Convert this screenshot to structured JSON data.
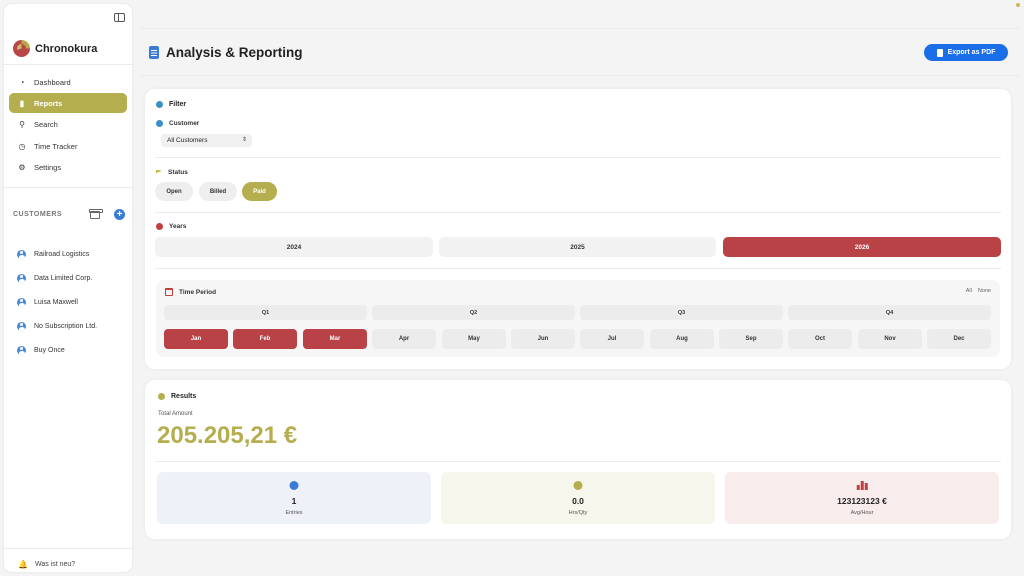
{
  "app": {
    "name": "Chronokura"
  },
  "colors": {
    "accent": "#b5ae4e",
    "primary": "#1a6ee8",
    "danger": "#b84246"
  },
  "sidebar": {
    "nav": [
      {
        "label": "Dashboard",
        "icon": "pie-chart-icon",
        "active": false
      },
      {
        "label": "Reports",
        "icon": "bar-chart-icon",
        "active": true
      },
      {
        "label": "Search",
        "icon": "search-icon",
        "active": false
      },
      {
        "label": "Time Tracker",
        "icon": "timer-icon",
        "active": false
      },
      {
        "label": "Settings",
        "icon": "gear-icon",
        "active": false
      }
    ],
    "customers_title": "CUSTOMERS",
    "customers": [
      "Railroad Logistics",
      "Data Limited Corp.",
      "Luisa Maxwell",
      "No Subscription Ltd.",
      "Buy Once"
    ],
    "whats_new": "Was ist neu?"
  },
  "header": {
    "title": "Analysis & Reporting",
    "export_label": "Export as PDF"
  },
  "filter": {
    "title": "Filter",
    "customer_label": "Customer",
    "customer_value": "All Customers",
    "status_label": "Status",
    "statuses": [
      {
        "label": "Open",
        "active": false
      },
      {
        "label": "Billed",
        "active": false
      },
      {
        "label": "Paid",
        "active": true
      }
    ],
    "years_label": "Years",
    "years": [
      {
        "label": "2024",
        "active": false
      },
      {
        "label": "2025",
        "active": false
      },
      {
        "label": "2026",
        "active": true
      }
    ],
    "period_label": "Time Period",
    "period_all": "All",
    "period_none": "None",
    "quarters": [
      "Q1",
      "Q2",
      "Q3",
      "Q4"
    ],
    "months": [
      {
        "label": "Jan",
        "active": true
      },
      {
        "label": "Feb",
        "active": true
      },
      {
        "label": "Mar",
        "active": true
      },
      {
        "label": "Apr",
        "active": false
      },
      {
        "label": "May",
        "active": false
      },
      {
        "label": "Jun",
        "active": false
      },
      {
        "label": "Jul",
        "active": false
      },
      {
        "label": "Aug",
        "active": false
      },
      {
        "label": "Sep",
        "active": false
      },
      {
        "label": "Oct",
        "active": false
      },
      {
        "label": "Nov",
        "active": false
      },
      {
        "label": "Dec",
        "active": false
      }
    ]
  },
  "results": {
    "title": "Results",
    "total_label": "Total Amount",
    "total_amount": "205.205,21 €",
    "stats": [
      {
        "value": "1",
        "label": "Entries",
        "icon": "list-icon",
        "bg": "#eef2f8",
        "icon_color": "#3a7bd5"
      },
      {
        "value": "0.0",
        "label": "Hrs/Qty",
        "icon": "clock-icon",
        "bg": "#f6f6ec",
        "icon_color": "#b5ae4e"
      },
      {
        "value": "123123123 €",
        "label": "Avg/Hour",
        "icon": "bar-chart-icon",
        "bg": "#f8ecec",
        "icon_color": "#c04040"
      }
    ]
  }
}
